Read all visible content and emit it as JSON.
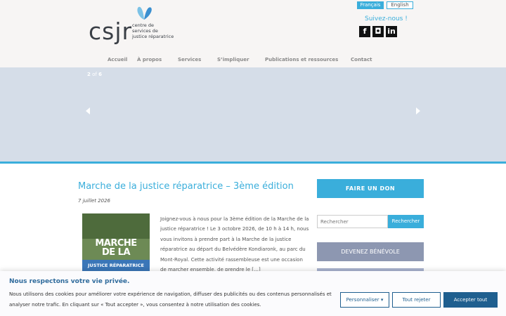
{
  "header": {
    "logo_word": "csjr",
    "logo_tagline_1": "centre de",
    "logo_tagline_2": "services de",
    "logo_tagline_3": "justice réparatrice",
    "lang_fr": "Français",
    "lang_en": "English",
    "follow_label": "Suivez-nous !",
    "social": [
      "f",
      "◘",
      "in"
    ]
  },
  "nav": {
    "items": [
      "Accueil",
      "À propos",
      "Services",
      "S’impliquer",
      "Publications et ressources",
      "Contact"
    ]
  },
  "slider": {
    "current": "2",
    "of_label": "of",
    "total": "6"
  },
  "post": {
    "title": "Marche de la justice réparatrice – 3ème édition",
    "date": "7 juillet 2026",
    "thumb_line1": "MARCHE",
    "thumb_line2": "DE LA",
    "thumb_line3": "JUSTICE RÉPARATRICE",
    "excerpt": "Joignez-vous à nous pour la 3ème édition de la Marche de la justice réparatrice ! Le 3 octobre 2026, de 10 h à 14 h, nous vous invitons à prendre part à la Marche de la justice réparatrice au départ du Belvédère Kondiaronk, au parc du Mont-Royal. Cette activité rassembleuse est une occasion de marcher ensemble, de prendre le […]"
  },
  "sidebar": {
    "donate_label": "FAIRE UN DON",
    "search_placeholder": "Rechercher",
    "search_button": "Rechercher",
    "volunteer_label": "DEVENEZ BÉNÉVOLE"
  },
  "cookie": {
    "title": "Nous respectons votre vie privée.",
    "text": "Nous utilisons des cookies pour améliorer votre expérience de navigation, diffuser des publicités ou des contenus personnalisés et analyser notre trafic. En cliquant sur « Tout accepter », vous consentez à notre utilisation des cookies.",
    "customize": "Personnaliser ▾",
    "reject": "Tout rejeter",
    "accept": "Accepter tout"
  },
  "colors": {
    "accent": "#3aaedb",
    "slider_bg": "#d5dde8",
    "volunteer": "#8d97b1",
    "cookie_button": "#1f5f8f"
  }
}
